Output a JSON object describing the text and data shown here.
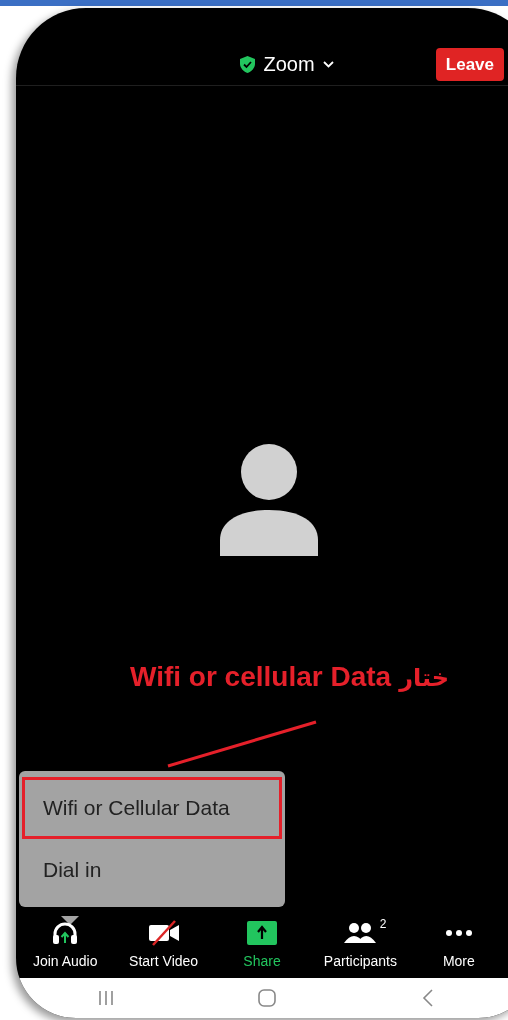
{
  "header": {
    "title": "Zoom",
    "leave_button": "Leave"
  },
  "annotation": {
    "text": "Wifi or cellular Data",
    "arabic": "ختار"
  },
  "audio_menu": {
    "items": [
      {
        "label": "Wifi or Cellular Data",
        "highlighted": true
      },
      {
        "label": "Dial in",
        "highlighted": false
      }
    ]
  },
  "toolbar": [
    {
      "kind": "audio",
      "label": "Join Audio"
    },
    {
      "kind": "video",
      "label": "Start Video"
    },
    {
      "kind": "share",
      "label": "Share"
    },
    {
      "kind": "participants",
      "label": "Participants",
      "badge": "2"
    },
    {
      "kind": "more",
      "label": "More"
    }
  ]
}
